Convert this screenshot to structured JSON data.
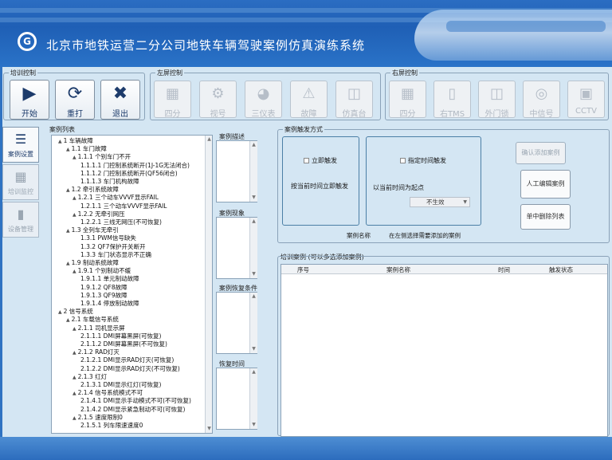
{
  "app": {
    "title": "北京市地铁运营二分公司地铁车辆驾驶案例仿真演练系统",
    "logo_text": "G"
  },
  "training_control": {
    "title": "培训控制",
    "buttons": [
      {
        "label": "开始",
        "icon": "play-icon"
      },
      {
        "label": "重打",
        "icon": "refresh-icon"
      },
      {
        "label": "退出",
        "icon": "close-icon"
      }
    ]
  },
  "left_screen_control": {
    "title": "左屏控制",
    "buttons": [
      {
        "label": "四分",
        "icon": "quad-split-icon"
      },
      {
        "label": "视号",
        "icon": "video-icon"
      },
      {
        "label": "三仪表",
        "icon": "gauge-icon"
      },
      {
        "label": "故障",
        "icon": "warning-icon"
      },
      {
        "label": "仿真台",
        "icon": "console-icon"
      }
    ]
  },
  "right_screen_control": {
    "title": "右屏控制",
    "buttons": [
      {
        "label": "四分",
        "icon": "quad-split-icon"
      },
      {
        "label": "右TMS",
        "icon": "tablet-icon"
      },
      {
        "label": "外门锁",
        "icon": "door-lock-icon"
      },
      {
        "label": "中信号",
        "icon": "signal-icon"
      },
      {
        "label": "CCTV",
        "icon": "camera-icon"
      }
    ]
  },
  "side_nav": {
    "items": [
      {
        "label": "案例设置",
        "icon": "case-settings-icon",
        "active": true
      },
      {
        "label": "培训监控",
        "icon": "book-icon",
        "active": false
      },
      {
        "label": "设备管理",
        "icon": "device-icon",
        "active": false
      }
    ]
  },
  "case_list": {
    "title": "案例列表",
    "tree": [
      {
        "level": 0,
        "text": "1 车辆故障",
        "toggle": "▲"
      },
      {
        "level": 1,
        "text": "1.1 车门故障",
        "toggle": "▲"
      },
      {
        "level": 2,
        "text": "1.1.1 个别车门不开",
        "toggle": "▲"
      },
      {
        "level": 3,
        "text": "1.1.1.1 门控制系统断开(1J-1G无法闭合)",
        "toggle": ""
      },
      {
        "level": 3,
        "text": "1.1.1.2 门控制系统断开(QF56闭合)",
        "toggle": ""
      },
      {
        "level": 3,
        "text": "1.1.1.3 车门机构故障",
        "toggle": ""
      },
      {
        "level": 1,
        "text": "1.2 牵引系统故障",
        "toggle": "▲"
      },
      {
        "level": 2,
        "text": "1.2.1 三个动车VVVF显示FAIL",
        "toggle": "▲"
      },
      {
        "level": 3,
        "text": "1.2.1.1 三个动车VVVF显示FAIL",
        "toggle": ""
      },
      {
        "level": 2,
        "text": "1.2.2 无牵引网压",
        "toggle": "▲"
      },
      {
        "level": 3,
        "text": "1.2.2.1 三线无网压(不可恢复)",
        "toggle": ""
      },
      {
        "level": 1,
        "text": "1.3 全列车无牵引",
        "toggle": "▲"
      },
      {
        "level": 3,
        "text": "1.3.1 PWM信号缺失",
        "toggle": ""
      },
      {
        "level": 3,
        "text": "1.3.2 QF7保护开关断开",
        "toggle": ""
      },
      {
        "level": 3,
        "text": "1.3.3 车门状态显示不正确",
        "toggle": ""
      },
      {
        "level": 1,
        "text": "1.9 制动系统故障",
        "toggle": "▲"
      },
      {
        "level": 2,
        "text": "1.9.1 个别制动不缓",
        "toggle": "▲"
      },
      {
        "level": 3,
        "text": "1.9.1.1 单元制动故障",
        "toggle": ""
      },
      {
        "level": 3,
        "text": "1.9.1.2 QF8故障",
        "toggle": ""
      },
      {
        "level": 3,
        "text": "1.9.1.3 QF9故障",
        "toggle": ""
      },
      {
        "level": 3,
        "text": "1.9.1.4 停放制动故障",
        "toggle": ""
      },
      {
        "level": 0,
        "text": "2 信号系统",
        "toggle": "▲"
      },
      {
        "level": 1,
        "text": "2.1 车载信号系统",
        "toggle": "▲"
      },
      {
        "level": 2,
        "text": "2.1.1 司机显示屏",
        "toggle": "▲"
      },
      {
        "level": 3,
        "text": "2.1.1.1 DMI屏幕黑屏(可恢复)",
        "toggle": ""
      },
      {
        "level": 3,
        "text": "2.1.1.2 DMI屏幕黑屏(不可恢复)",
        "toggle": ""
      },
      {
        "level": 2,
        "text": "2.1.2 RAD灯灭",
        "toggle": "▲"
      },
      {
        "level": 3,
        "text": "2.1.2.1 DMI显示RAD灯灭(可恢复)",
        "toggle": ""
      },
      {
        "level": 3,
        "text": "2.1.2.2 DMI显示RAD灯灭(不可恢复)",
        "toggle": ""
      },
      {
        "level": 2,
        "text": "2.1.3 红灯",
        "toggle": "▲"
      },
      {
        "level": 3,
        "text": "2.1.3.1 DMI显示红灯(可恢复)",
        "toggle": ""
      },
      {
        "level": 2,
        "text": "2.1.4 信号系统模式不可",
        "toggle": "▲"
      },
      {
        "level": 3,
        "text": "2.1.4.1 DMI显示手动模式不可(不可恢复)",
        "toggle": ""
      },
      {
        "level": 3,
        "text": "2.1.4.2 DMI显示紧急制动不可(可恢复)",
        "toggle": ""
      },
      {
        "level": 2,
        "text": "2.1.5 速度限制0",
        "toggle": "▲"
      },
      {
        "level": 3,
        "text": "2.1.5.1 列车限速速度0",
        "toggle": ""
      }
    ]
  },
  "case_desc": {
    "title": "案例描述"
  },
  "case_phenomenon": {
    "title": "案例现象"
  },
  "case_recovery": {
    "title": "案例恢复条件"
  },
  "recovery_time": {
    "title": "恢复时间"
  },
  "case_trigger": {
    "title": "案例触发方式",
    "manual": {
      "checkbox_label": "立即触发",
      "note": "按当前时间立即触发"
    },
    "timed": {
      "checkbox_label": "指定时间触发",
      "field_label": "以当前时间为起点",
      "select_value": "不生效"
    },
    "buttons": {
      "add": "确认添加案例",
      "edit": "人工编辑案例",
      "remove": "单中删除列表"
    },
    "case_name_label": "案例名称",
    "hint": "在左侧选择需要添加的案例"
  },
  "training_list": {
    "title": "培训案例 (可以多选添加案例)",
    "columns": [
      "序号",
      "案例名称",
      "时间",
      "触发状态"
    ]
  },
  "colors": {
    "header_blue": "#1f5fb5",
    "panel_bg": "#d4e6f3",
    "accent": "#1d3b6b"
  }
}
